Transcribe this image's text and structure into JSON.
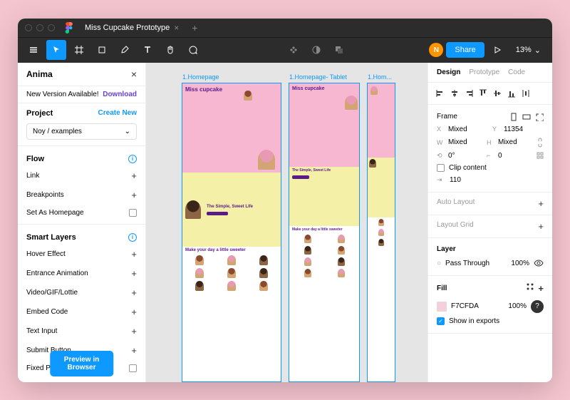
{
  "titlebar": {
    "tab": "Miss Cupcake Prototype"
  },
  "toolbar": {
    "avatar_initial": "N",
    "share": "Share",
    "zoom": "13%"
  },
  "anima": {
    "title": "Anima",
    "banner_msg": "New Version Available!",
    "banner_action": "Download",
    "project_label": "Project",
    "create_new": "Create New",
    "project_value": "Noy / examples",
    "flow_label": "Flow",
    "flow_items": [
      {
        "label": "Link",
        "control": "plus"
      },
      {
        "label": "Breakpoints",
        "control": "plus"
      },
      {
        "label": "Set As Homepage",
        "control": "checkbox"
      }
    ],
    "smart_label": "Smart Layers",
    "smart_items": [
      {
        "label": "Hover Effect",
        "control": "plus"
      },
      {
        "label": "Entrance Animation",
        "control": "plus"
      },
      {
        "label": "Video/GIF/Lottie",
        "control": "plus"
      },
      {
        "label": "Embed Code",
        "control": "plus"
      },
      {
        "label": "Text Input",
        "control": "plus"
      },
      {
        "label": "Submit Button",
        "control": "plus"
      },
      {
        "label": "Fixed Position",
        "control": "checkbox"
      }
    ],
    "preview_btn": "Preview in Browser"
  },
  "canvas": {
    "artboards": [
      {
        "label": "1.Homepage"
      },
      {
        "label": "1.Homepage- Tablet"
      },
      {
        "label": "1.Hom..."
      }
    ],
    "mock": {
      "title": "Miss cupcake",
      "tagline": "The Simple, Sweet Life",
      "cta": "Make your day a little sweeter"
    }
  },
  "design": {
    "tabs": {
      "design": "Design",
      "prototype": "Prototype",
      "code": "Code"
    },
    "frame_label": "Frame",
    "x": "Mixed",
    "y": "11354",
    "w": "Mixed",
    "h": "Mixed",
    "rotation": "0°",
    "radius": "0",
    "clip_label": "Clip content",
    "spacing": "110",
    "auto_layout": "Auto Layout",
    "layout_grid": "Layout Grid",
    "layer_label": "Layer",
    "blend": "Pass Through",
    "opacity": "100%",
    "fill_label": "Fill",
    "fill_hex": "F7CFDA",
    "fill_opacity": "100%",
    "show_exports": "Show in exports"
  }
}
